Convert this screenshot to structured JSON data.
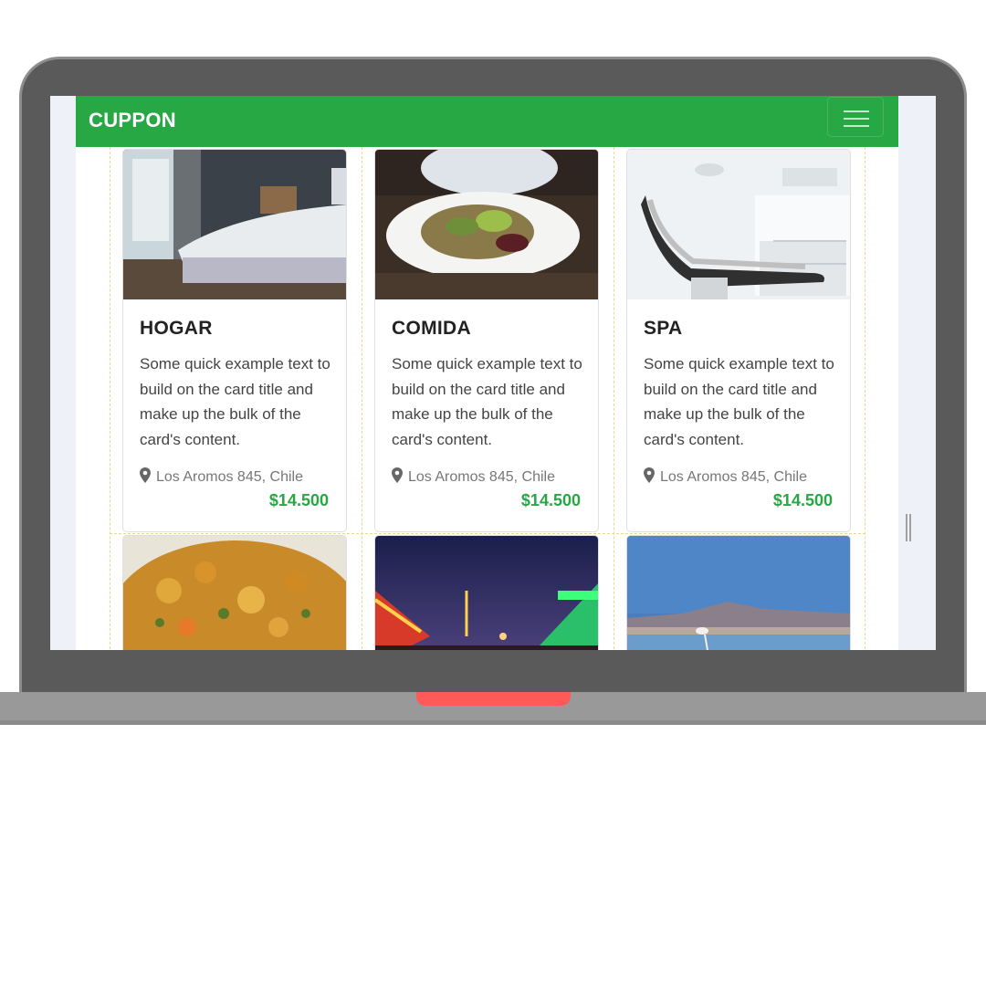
{
  "navbar": {
    "brand": "CUPPON",
    "menu_icon": "hamburger-menu-icon"
  },
  "colors": {
    "brand_green": "#28a745",
    "accent_red": "#ff5a57",
    "laptop_frame": "#5a5a5a"
  },
  "cards": [
    {
      "title": "HOGAR",
      "text": "Some quick example text to build on the card title and make up the bulk of the card's content.",
      "location": "Los Aromos 845, Chile",
      "price": "$14.500",
      "image": "bedroom-photo"
    },
    {
      "title": "COMIDA",
      "text": "Some quick example text to build on the card title and make up the bulk of the card's content.",
      "location": "Los Aromos 845, Chile",
      "price": "$14.500",
      "image": "salad-plate-photo"
    },
    {
      "title": "SPA",
      "text": "Some quick example text to build on the card title and make up the bulk of the card's content.",
      "location": "Los Aromos 845, Chile",
      "price": "$14.500",
      "image": "dental-chair-photo"
    },
    {
      "image": "curry-dish-photo"
    },
    {
      "image": "night-fair-photo"
    },
    {
      "image": "salt-flat-flamingo-photo"
    }
  ]
}
